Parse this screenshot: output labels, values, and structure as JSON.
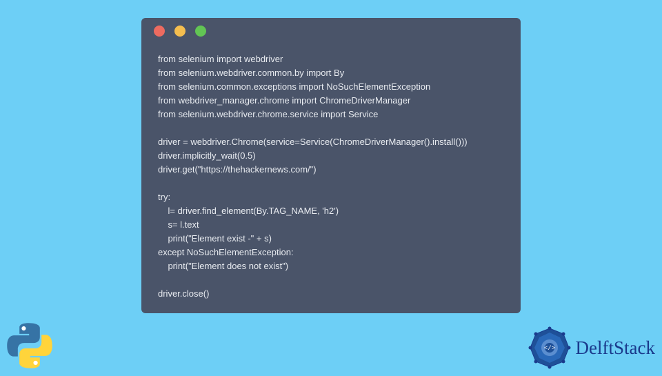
{
  "code": {
    "line1": "from selenium import webdriver",
    "line2": "from selenium.webdriver.common.by import By",
    "line3": "from selenium.common.exceptions import NoSuchElementException",
    "line4": "from webdriver_manager.chrome import ChromeDriverManager",
    "line5": "from selenium.webdriver.chrome.service import Service",
    "line6": "",
    "line7": "driver = webdriver.Chrome(service=Service(ChromeDriverManager().install()))",
    "line8": "driver.implicitly_wait(0.5)",
    "line9": "driver.get(\"https://thehackernews.com/\")",
    "line10": "",
    "line11": "try:",
    "line12": "    l= driver.find_element(By.TAG_NAME, 'h2')",
    "line13": "    s= l.text",
    "line14": "    print(\"Element exist -\" + s)",
    "line15": "except NoSuchElementException:",
    "line16": "    print(\"Element does not exist\")",
    "line17": "",
    "line18": "driver.close()"
  },
  "brand": {
    "name": "DelftStack"
  }
}
